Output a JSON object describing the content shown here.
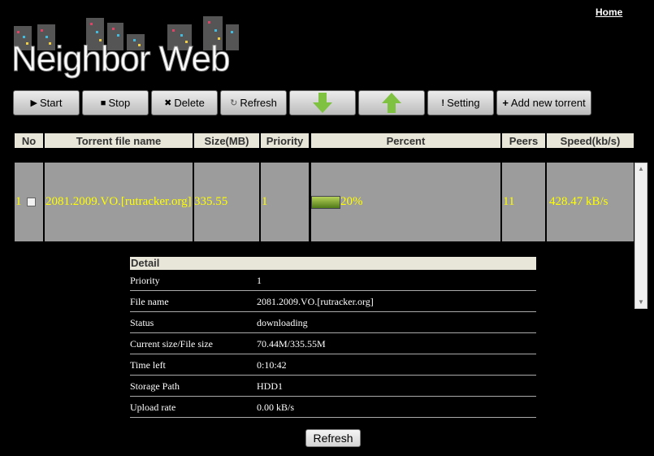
{
  "header": {
    "home_link": "Home",
    "logo_text": "Neighbor Web"
  },
  "toolbar": {
    "start": "Start",
    "stop": "Stop",
    "delete": "Delete",
    "refresh": "Refresh",
    "setting": "Setting",
    "add_new": "Add new torrent",
    "colors": {
      "arrow": "#7fc242"
    }
  },
  "table": {
    "columns": [
      "No",
      "Torrent file name",
      "Size(MB)",
      "Priority",
      "Percent",
      "Peers",
      "Speed(kb/s)"
    ],
    "rows": [
      {
        "no": "1",
        "name": "2081.2009.VO.[rutracker.org]",
        "size": "335.55",
        "priority": "1",
        "percent": "20%",
        "progress": 0.2,
        "peers": "11",
        "speed": "428.47 kB/s"
      }
    ]
  },
  "detail": {
    "title": "Detail",
    "rows": [
      {
        "label": "Priority",
        "value": "1"
      },
      {
        "label": "File name",
        "value": "2081.2009.VO.[rutracker.org]"
      },
      {
        "label": "Status",
        "value": "downloading"
      },
      {
        "label": "Current size/File size",
        "value": "70.44M/335.55M"
      },
      {
        "label": "Time left",
        "value": "0:10:42"
      },
      {
        "label": "Storage Path",
        "value": "HDD1"
      },
      {
        "label": "Upload rate",
        "value": "0.00 kB/s"
      }
    ]
  },
  "footer": {
    "refresh": "Refresh"
  },
  "colors": {
    "row_text": "#ffff00",
    "row_bg": "#9c9c9c",
    "header_bg": "#e8e6d8"
  }
}
